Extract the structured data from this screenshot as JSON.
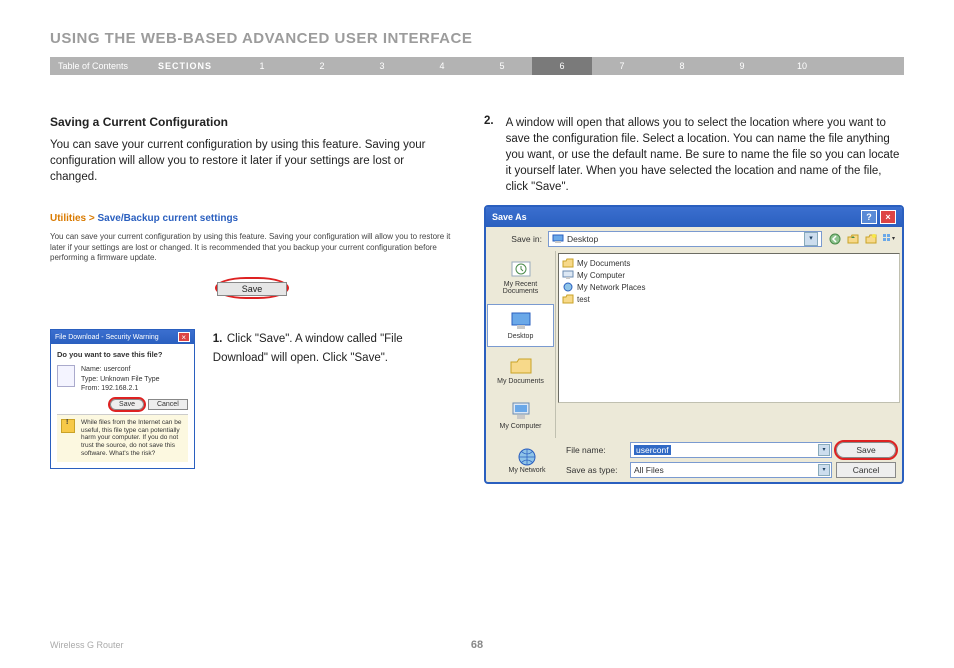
{
  "page": {
    "title": "USING THE WEB-BASED ADVANCED USER INTERFACE",
    "footer_product": "Wireless G Router",
    "page_number": "68"
  },
  "nav": {
    "toc": "Table of Contents",
    "sections_label": "SECTIONS",
    "numbers": [
      "1",
      "2",
      "3",
      "4",
      "5",
      "6",
      "7",
      "8",
      "9",
      "10"
    ],
    "active_index": 5
  },
  "left": {
    "heading": "Saving a Current Configuration",
    "intro": "You can save your current configuration by using this feature. Saving your configuration will allow you to restore it later if your settings are lost or changed.",
    "breadcrumb_a": "Utilities > ",
    "breadcrumb_b": "Save/Backup current settings",
    "small_text": "You can save your current configuration by using this feature. Saving your configuration will allow you to restore it later if your settings are lost or changed. It is recommended that you backup your current configuration before performing a firmware update.",
    "save_btn": "Save",
    "step1_num": "1.",
    "step1_text": "Click \"Save\". A window called \"File Download\" will open. Click \"Save\"."
  },
  "file_download": {
    "title": "File Download - Security Warning",
    "question": "Do you want to save this file?",
    "name_label": "Name:",
    "name_value": "userconf",
    "type_label": "Type:",
    "type_value": "Unknown File Type",
    "from_label": "From:",
    "from_value": "192.168.2.1",
    "btn_save": "Save",
    "btn_cancel": "Cancel",
    "warning": "While files from the Internet can be useful, this file type can potentially harm your computer. If you do not trust the source, do not save this software. What's the risk?"
  },
  "right": {
    "step2_num": "2.",
    "step2_text": "A window will open that allows you to select the location where you want to save the configuration file. Select a location. You can name the file anything you want, or use the default name. Be sure to name the file so you can locate it yourself later. When you have selected the location and name of the file, click \"Save\"."
  },
  "save_as": {
    "title": "Save As",
    "save_in_label": "Save in:",
    "save_in_value": "Desktop",
    "places": {
      "recent": "My Recent Documents",
      "desktop": "Desktop",
      "mydocs": "My Documents",
      "mycomp": "My Computer",
      "mynet": "My Network"
    },
    "listing": [
      "My Documents",
      "My Computer",
      "My Network Places",
      "test"
    ],
    "filename_label": "File name:",
    "filename_value": "userconf",
    "saveastype_label": "Save as type:",
    "saveastype_value": "All Files",
    "btn_save": "Save",
    "btn_cancel": "Cancel"
  }
}
